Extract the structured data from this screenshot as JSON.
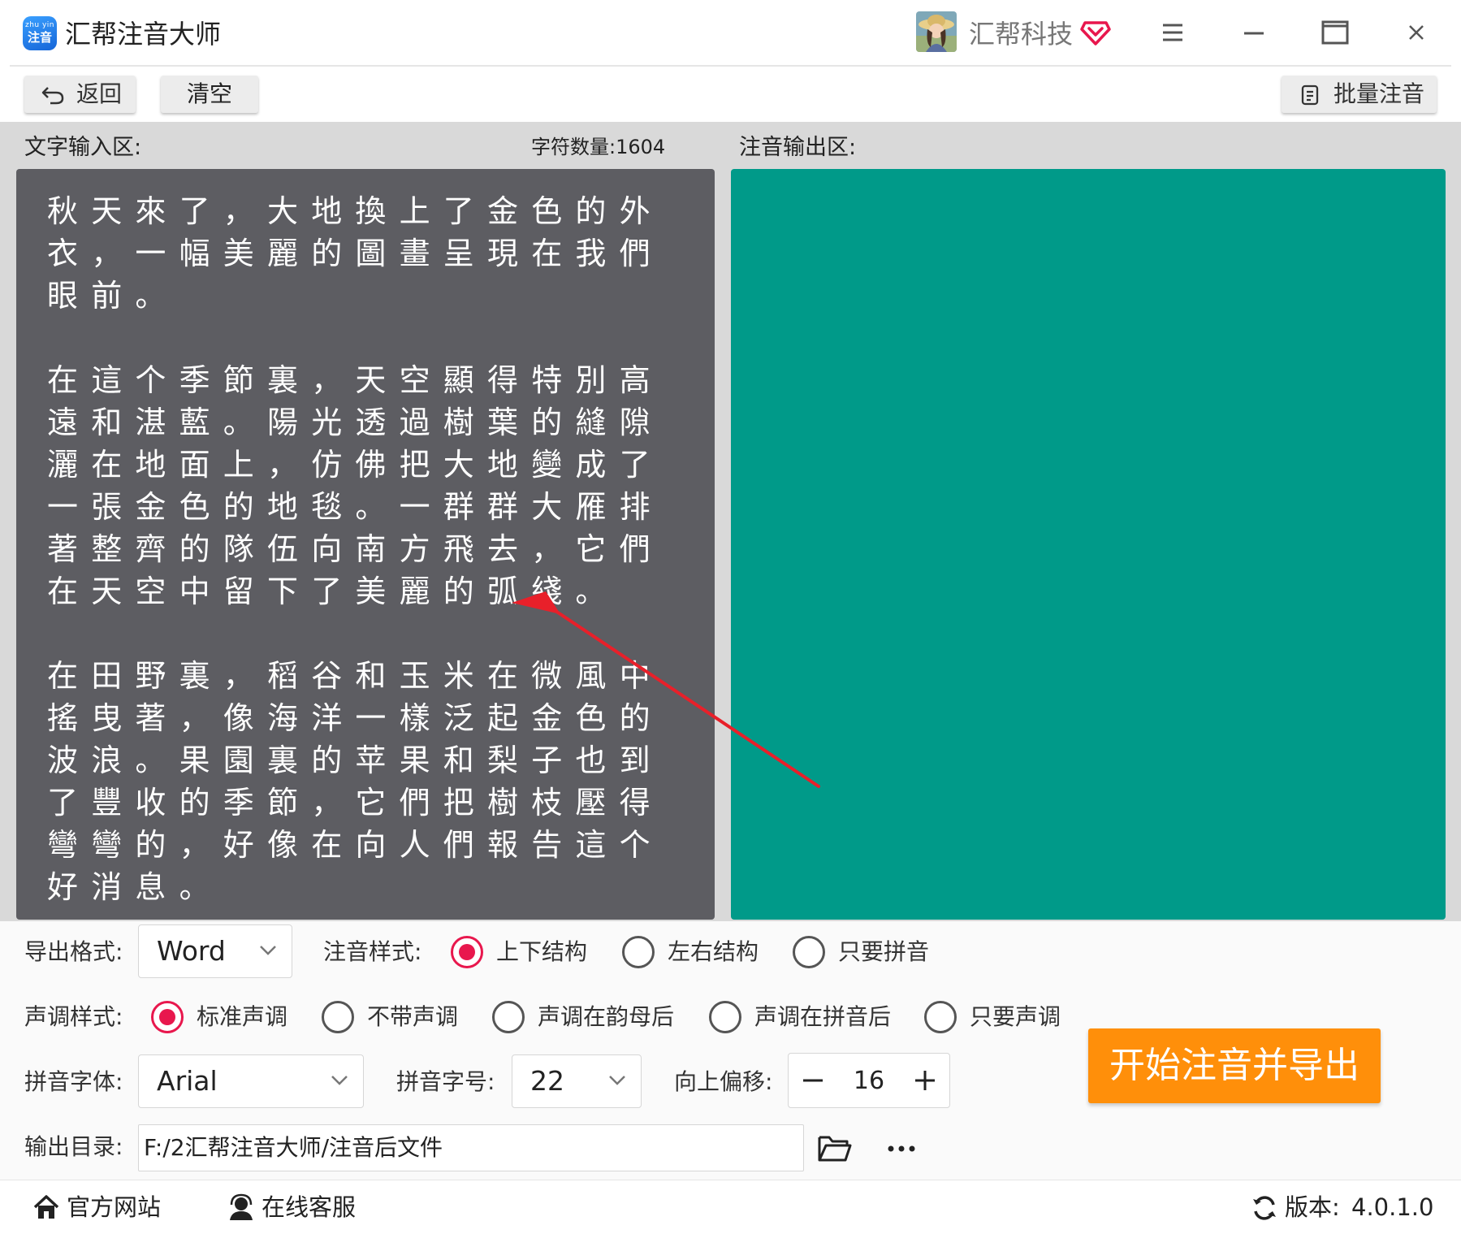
{
  "window": {
    "app_logo_top": "zhu yin",
    "app_logo_bottom": "注音",
    "app_title": "汇帮注音大师",
    "company": "汇帮科技"
  },
  "toolbar": {
    "back_label": "返回",
    "clear_label": "清空",
    "batch_label": "批量注音"
  },
  "input": {
    "label": "文字输入区:",
    "char_count_label": "字符数量:",
    "char_count": "1604",
    "text": "秋天來了，大地換上了金色的外衣，一幅美麗的圖畫呈現在我們眼前。\n\n在這个季節裏，天空顯得特別高遠和湛藍。陽光透過樹葉的縫隙灑在地面上，仿佛把大地變成了一張金色的地毯。一群群大雁排著整齊的隊伍向南方飛去，它們在天空中留下了美麗的弧綫。\n\n在田野裏，稻谷和玉米在微風中搖曳著，像海洋一樣泛起金色的波浪。果園裏的苹果和梨子也到了豐收的季節，它們把樹枝壓得彎彎的，好像在向人們報告這个好消息。"
  },
  "output": {
    "label": "注音输出区:",
    "bg_color": "#009a89"
  },
  "settings": {
    "export_format_label": "导出格式:",
    "export_format_value": "Word",
    "style_label": "注音样式:",
    "style_options": [
      "上下结构",
      "左右结构",
      "只要拼音"
    ],
    "style_selected": 0,
    "tone_label": "声调样式:",
    "tone_options": [
      "标准声调",
      "不带声调",
      "声调在韵母后",
      "声调在拼音后",
      "只要声调"
    ],
    "tone_selected": 0,
    "font_label": "拼音字体:",
    "font_value": "Arial",
    "size_label": "拼音字号:",
    "size_value": "22",
    "offset_label": "向上偏移:",
    "offset_value": "16",
    "start_button": "开始注音并导出",
    "output_dir_label": "输出目录:",
    "output_dir_value": "F:/2汇帮注音大师/注音后文件",
    "accent_color": "#e8174d",
    "start_button_color": "#ff8f0a"
  },
  "footer": {
    "home_label": "官方网站",
    "service_label": "在线客服",
    "version_label": "版本:",
    "version_value": "4.0.1.0"
  }
}
